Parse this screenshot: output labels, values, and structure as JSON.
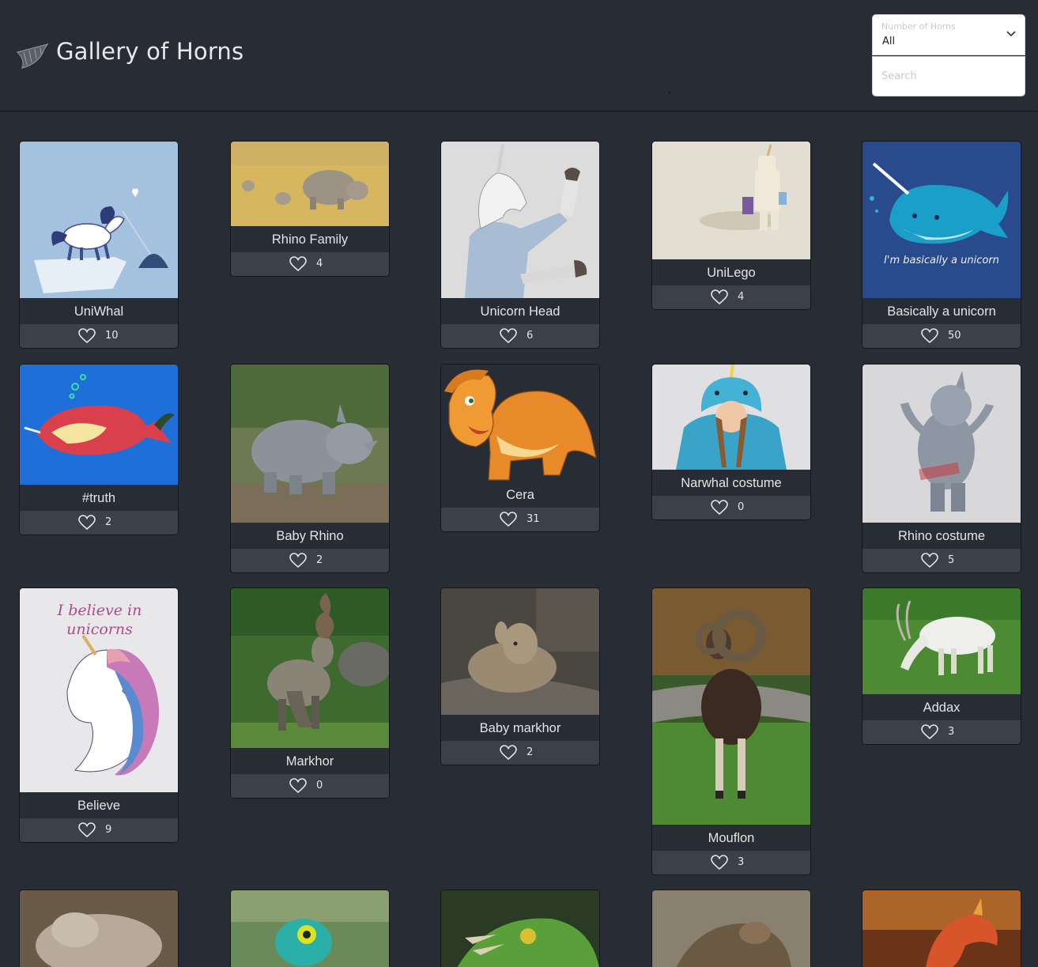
{
  "header": {
    "title": "Gallery of Horns",
    "logo_icon": "horn-icon"
  },
  "filter": {
    "label": "Number of Horns",
    "value": "All"
  },
  "search": {
    "placeholder": "Search",
    "value": ""
  },
  "colors": {
    "background": "#282c34",
    "card": "#3b404b",
    "text": "#e6e6e6"
  },
  "cards": [
    {
      "title": "UniWhal",
      "likes": "10"
    },
    {
      "title": "Rhino Family",
      "likes": "4"
    },
    {
      "title": "Unicorn Head",
      "likes": "6"
    },
    {
      "title": "UniLego",
      "likes": "4"
    },
    {
      "title": "Basically a unicorn",
      "likes": "50",
      "image_caption": "I'm basically a unicorn"
    },
    {
      "title": "#truth",
      "likes": "2"
    },
    {
      "title": "Baby Rhino",
      "likes": "2"
    },
    {
      "title": "Cera",
      "likes": "31"
    },
    {
      "title": "Narwhal costume",
      "likes": "0"
    },
    {
      "title": "Rhino costume",
      "likes": "5"
    },
    {
      "title": "Believe",
      "likes": "9",
      "image_caption": "I believe in unicorns"
    },
    {
      "title": "Markhor",
      "likes": "0"
    },
    {
      "title": "Baby markhor",
      "likes": "2"
    },
    {
      "title": "Mouflon",
      "likes": "3"
    },
    {
      "title": "Addax",
      "likes": "3"
    },
    {
      "title": "",
      "likes": ""
    },
    {
      "title": "",
      "likes": ""
    },
    {
      "title": "",
      "likes": ""
    },
    {
      "title": "",
      "likes": ""
    },
    {
      "title": "",
      "likes": ""
    }
  ]
}
